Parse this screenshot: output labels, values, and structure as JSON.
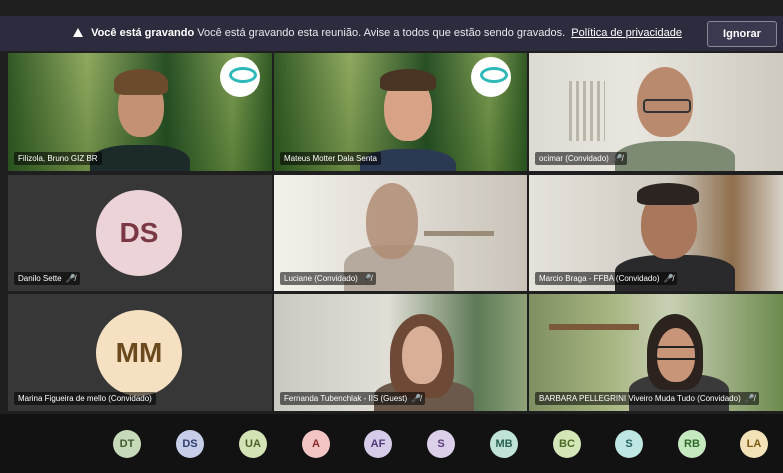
{
  "banner": {
    "title": "Você está gravando",
    "message": "Você está gravando esta reunião. Avise a todos que estão sendo gravados.",
    "link": "Política de privacidade",
    "dismiss_label": "Ignorar"
  },
  "tiles": [
    {
      "name": "Filizola, Bruno GIZ BR",
      "muted": false
    },
    {
      "name": "Mateus Motter Dala Senta",
      "muted": false
    },
    {
      "name": "ocimar (Convidado)",
      "muted": true
    },
    {
      "name": "Danilo Sette",
      "muted": true,
      "initials": "DS"
    },
    {
      "name": "Luciane (Convidado)",
      "muted": true
    },
    {
      "name": "Marcio Braga - FFBA (Convidado)",
      "muted": true
    },
    {
      "name": "Marina Figueira de mello (Convidado)",
      "muted": false,
      "initials": "MM"
    },
    {
      "name": "Fernanda Tubenchlak - IIS (Guest)",
      "muted": true
    },
    {
      "name": "BARBARA PELLEGRINI Viveiro Muda Tudo (Convidado)",
      "muted": true
    }
  ],
  "participants_bar": [
    {
      "initials": "DT",
      "bg": "#c6d9b8",
      "fg": "#3d5a2e"
    },
    {
      "initials": "DS",
      "bg": "#c7cfe8",
      "fg": "#2f3d70"
    },
    {
      "initials": "UA",
      "bg": "#d3e3b5",
      "fg": "#4a6228"
    },
    {
      "initials": "A",
      "bg": "#f2c4c4",
      "fg": "#8a2a2a"
    },
    {
      "initials": "AF",
      "bg": "#d6cbe8",
      "fg": "#4d3a78"
    },
    {
      "initials": "S",
      "bg": "#dccfe9",
      "fg": "#5a3f7a"
    },
    {
      "initials": "MB",
      "bg": "#bfe3d6",
      "fg": "#2a6050"
    },
    {
      "initials": "BC",
      "bg": "#d3e6b8",
      "fg": "#4a6a25"
    },
    {
      "initials": "S",
      "bg": "#bfe6e3",
      "fg": "#22645f"
    },
    {
      "initials": "RB",
      "bg": "#c6e8c0",
      "fg": "#2f6a2a"
    },
    {
      "initials": "LA",
      "bg": "#f3e2b7",
      "fg": "#7a5a12"
    }
  ],
  "icons": {
    "warning": "warning-triangle-icon",
    "mic_off": "mic-off-icon"
  },
  "colors": {
    "banner_bg": "#2d2c3e",
    "avatar_ds_bg": "#ecd3d7",
    "avatar_ds_fg": "#7a3844",
    "avatar_mm_bg": "#f6e0c2",
    "avatar_mm_fg": "#6b4a1e"
  }
}
